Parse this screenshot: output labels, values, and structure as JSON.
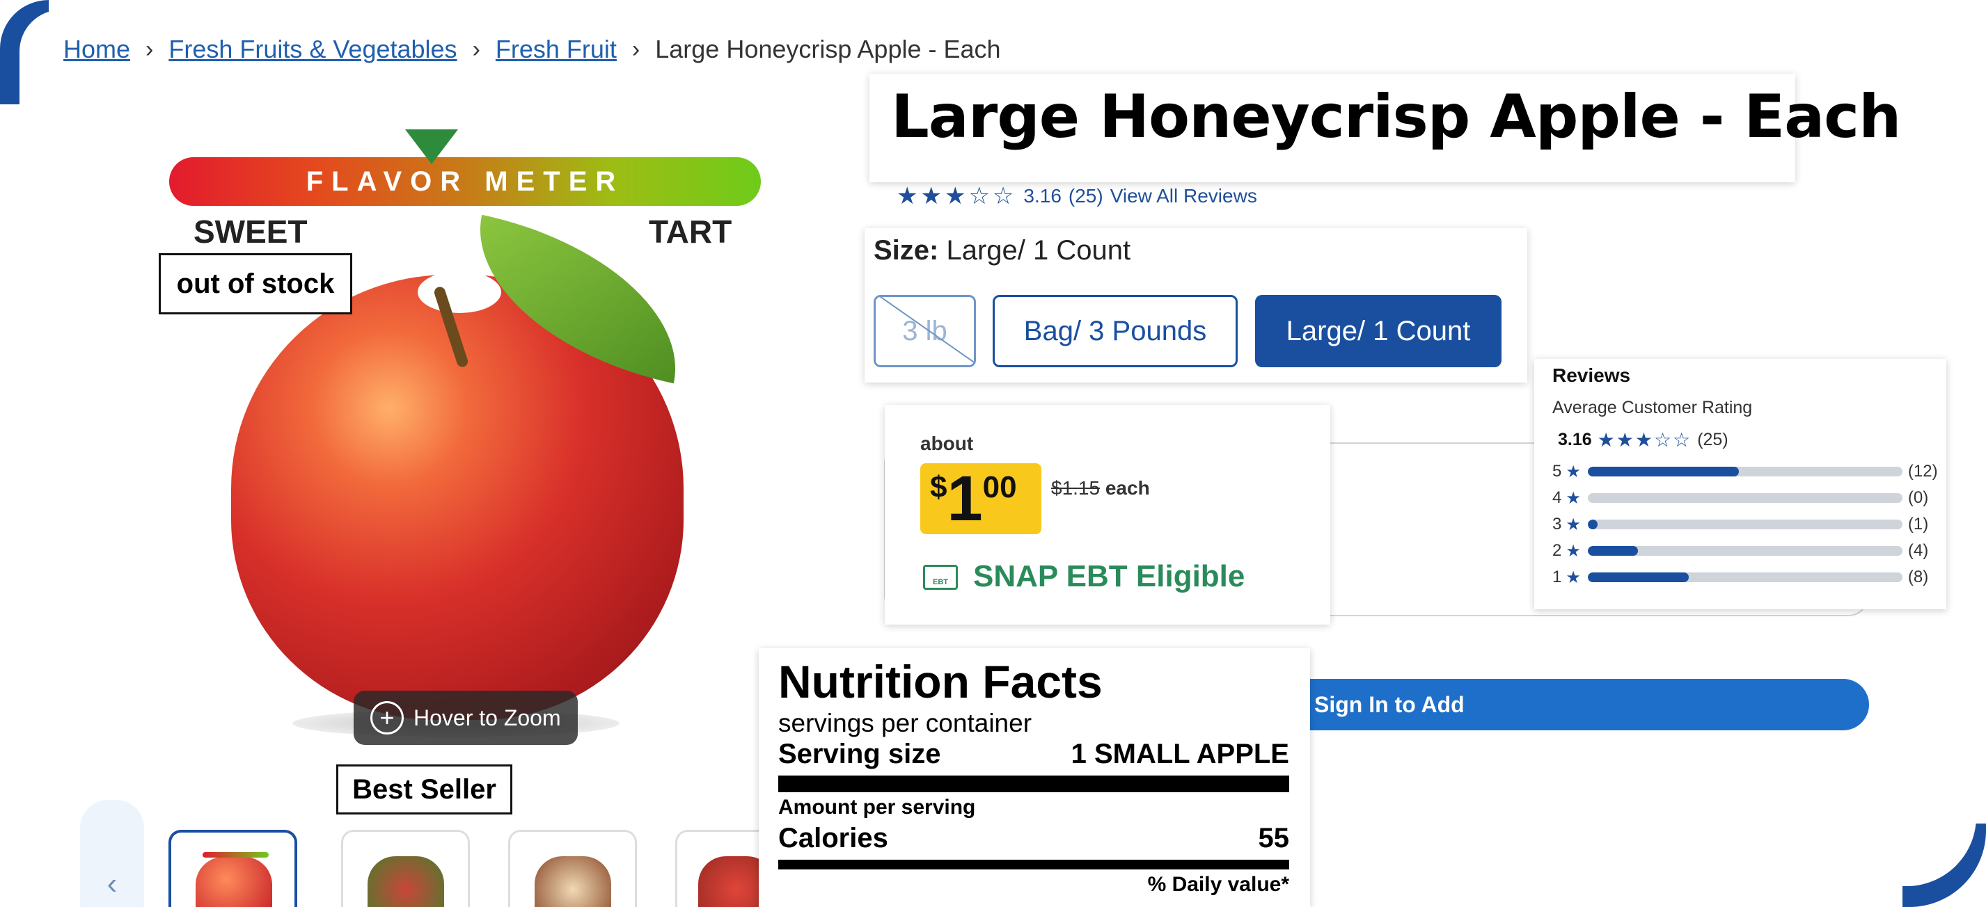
{
  "breadcrumb": {
    "items": [
      "Home",
      "Fresh Fruits & Vegetables",
      "Fresh Fruit"
    ],
    "separator": "›",
    "current": "Large Honeycrisp Apple - Each"
  },
  "product": {
    "title": "Large Honeycrisp Apple - Each",
    "rating_value": "3.16",
    "rating_stars": 3,
    "rating_count": "(25)",
    "view_reviews": "View All Reviews"
  },
  "image": {
    "flavor_meter": "FLAVOR METER",
    "sweet": "SWEET",
    "tart": "TART",
    "out_of_stock": "out of stock",
    "hover_zoom": "Hover to Zoom",
    "zoom_symbol": "+",
    "best_seller": "Best Seller",
    "prev_arrow": "‹"
  },
  "size": {
    "label": "Size:",
    "selected": "Large/ 1 Count",
    "options": [
      "3 lb",
      "Bag/ 3 Pounds",
      "Large/ 1 Count"
    ]
  },
  "price": {
    "about": "about",
    "currency": "$",
    "dollars": "1",
    "cents": "00",
    "was": "$1.15",
    "unit": "each",
    "snap_icon_text": "EBT",
    "snap": "SNAP EBT Eligible"
  },
  "actions": {
    "sign_in": "Sign In to Add"
  },
  "reviews": {
    "title": "Reviews",
    "subtitle": "Average Customer Rating",
    "average": "3.16",
    "count": "(25)",
    "breakdown": [
      {
        "stars": "5",
        "count": "(12)",
        "share": 0.48
      },
      {
        "stars": "4",
        "count": "(0)",
        "share": 0.0
      },
      {
        "stars": "3",
        "count": "(1)",
        "share": 0.04
      },
      {
        "stars": "2",
        "count": "(4)",
        "share": 0.16
      },
      {
        "stars": "1",
        "count": "(8)",
        "share": 0.32
      }
    ]
  },
  "nutrition": {
    "title": "Nutrition Facts",
    "servings": "servings per container",
    "serving_size_label": "Serving size",
    "serving_size_value": "1 SMALL APPLE",
    "amount_per_serving": "Amount per serving",
    "calories_label": "Calories",
    "calories_value": "55",
    "daily_value": "% Daily value*"
  },
  "colors": {
    "brand_blue": "#1a4fa0",
    "link_blue": "#1f5fae",
    "sale_yellow": "#f9c81d",
    "snap_green": "#2a8b5a"
  }
}
